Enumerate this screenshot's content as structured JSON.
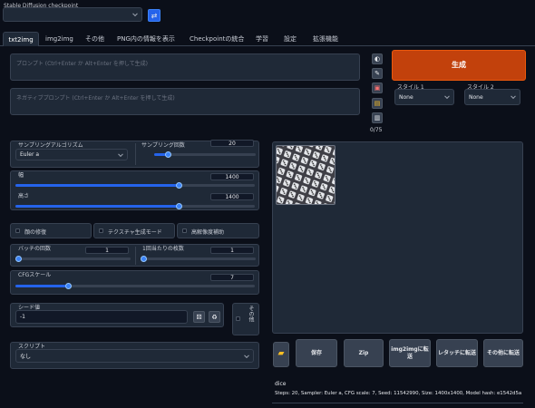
{
  "header": {
    "checkpoint_label": "Stable Diffusion checkpoint",
    "checkpoint_value": ""
  },
  "tabs": [
    {
      "label": "txt2img",
      "active": true
    },
    {
      "label": "img2img"
    },
    {
      "label": "その他"
    },
    {
      "label": "PNG内の情報を表示"
    },
    {
      "label": "Checkpointの統合"
    },
    {
      "label": "学習"
    },
    {
      "label": "設定"
    },
    {
      "label": "拡張機能"
    }
  ],
  "prompt": {
    "placeholder": "プロンプト (Ctrl+Enter か Alt+Enter を押して生成)",
    "negative_placeholder": "ネガティブプロンプト (Ctrl+Enter か Alt+Enter を押して生成)",
    "token_count": "0/75"
  },
  "generate": {
    "label": "生成",
    "style1_label": "スタイル 1",
    "style1_value": "None",
    "style2_label": "スタイル 2",
    "style2_value": "None"
  },
  "settings": {
    "sampler_label": "サンプリングアルゴリズム",
    "sampler_value": "Euler a",
    "steps_label": "サンプリング回数",
    "steps_value": "20",
    "steps_fraction": 0.13,
    "width_label": "幅",
    "width_value": "1400",
    "width_fraction": 0.68,
    "height_label": "高さ",
    "height_value": "1400",
    "height_fraction": 0.68,
    "restore_faces": "顔の修復",
    "tiling": "テクスチャ生成モード",
    "hires_fix": "高解像度補助",
    "batch_count_label": "バッチの回数",
    "batch_count_value": "1",
    "batch_count_fraction": 0.0,
    "batch_size_label": "1回当たりの枚数",
    "batch_size_value": "1",
    "batch_size_fraction": 0.0,
    "cfg_label": "CFGスケール",
    "cfg_value": "7",
    "cfg_fraction": 0.22,
    "seed_label": "シード値",
    "seed_value": "-1",
    "other_label": "その他",
    "script_label": "スクリプト",
    "script_value": "なし"
  },
  "output": {
    "save_label": "保存",
    "zip_label": "Zip",
    "to_img2img_label": "img2imgに転送",
    "to_inpaint_label": "レタッチに転送",
    "to_extras_label": "その他に転送",
    "caption": "dice",
    "info": "Steps: 20, Sampler: Euler a, CFG scale: 7, Seed: 11542990, Size: 1400x1400, Model hash: e1542d5a"
  },
  "colors": {
    "generate": "#c2410c",
    "accent": "#2563eb"
  }
}
